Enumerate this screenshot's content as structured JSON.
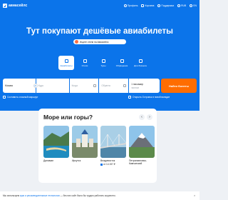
{
  "header": {
    "logo_text": "авиасейлс",
    "nav": [
      {
        "label": "Профиль",
        "icon": "profile-icon"
      },
      {
        "label": "Корзина",
        "icon": "cart-icon"
      },
      {
        "label": "Поддержка",
        "icon": "help-icon"
      },
      {
        "label": "RUB",
        "icon": "currency-icon"
      },
      {
        "label": "EN",
        "icon": "language-icon"
      }
    ]
  },
  "hero": {
    "title": "Тут покупают дешёвые авиабилеты",
    "promo": "Ищите отели на Авиасейлс"
  },
  "tabs": [
    {
      "label": "Авиабилеты",
      "icon": "plane-icon",
      "active": true
    },
    {
      "label": "Отели",
      "icon": "hotel-icon",
      "active": false
    },
    {
      "label": "Туры",
      "icon": "beach-icon",
      "active": false
    },
    {
      "label": "Обращения",
      "icon": "chat-icon",
      "active": false
    },
    {
      "label": "Для бизнеса",
      "icon": "briefcase-icon",
      "active": false
    }
  ],
  "search": {
    "from_value": "Москва",
    "to_placeholder": "Куда",
    "date_placeholder": "Когда",
    "return_placeholder": "Обратно",
    "passengers_value": "1 пассажир",
    "class_value": "эконом",
    "button_label": "Найти билеты"
  },
  "options": {
    "complex_route": "Составить сложный маршрут",
    "open_booking": "Открыть Островок в новой вкладке"
  },
  "recommendations": {
    "title": "Море или горы?",
    "items": [
      {
        "name": "Даламан",
        "price": ""
      },
      {
        "name": "Иркутск",
        "price": ""
      },
      {
        "name": "Владивосток",
        "price": "от 14 197 ₽"
      },
      {
        "name": "Петропавловск-Камчатский",
        "price": ""
      }
    ]
  },
  "cookie_bar": {
    "prefix": "Мы используем",
    "link": "куки и рекомендательные технологии",
    "suffix": "— без них сайт было бы трудно работать корректно."
  },
  "colors": {
    "brand_blue": "#0b74ea",
    "search_orange": "#ff6d00",
    "page_bg": "#eef1f5"
  }
}
